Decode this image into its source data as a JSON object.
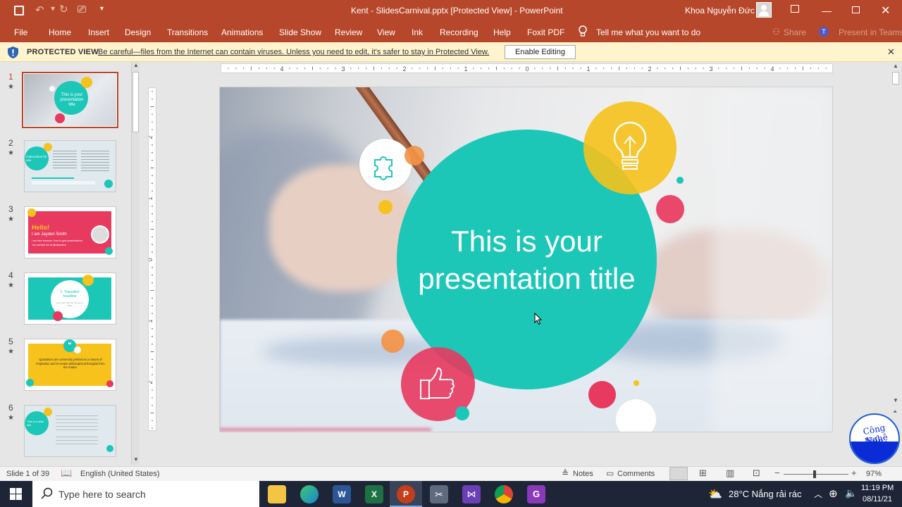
{
  "titlebar": {
    "doc_title": "Kent - SlidesCarnival.pptx [Protected View]  -  PowerPoint",
    "user_name": "Khoa Nguyễn Đức"
  },
  "ribbon": {
    "tabs": [
      "File",
      "Home",
      "Insert",
      "Design",
      "Transitions",
      "Animations",
      "Slide Show",
      "Review",
      "View",
      "Ink",
      "Recording",
      "Help",
      "Foxit PDF"
    ],
    "tell_me": "Tell me what you want to do",
    "share": "Share",
    "present_teams": "Present in Teams"
  },
  "protected": {
    "label": "PROTECTED VIEW",
    "message": "Be careful—files from the Internet can contain viruses. Unless you need to edit, it's safer to stay in Protected View.",
    "button": "Enable Editing"
  },
  "thumbnails": [
    {
      "num": "1",
      "title": "This is your presentation title"
    },
    {
      "num": "2",
      "title": "Instructions for use"
    },
    {
      "num": "3",
      "title": "Hello!",
      "sub": "I am Jayden Smith",
      "line1": "I am here because I love to give presentations.",
      "line2": "You can find me at @username"
    },
    {
      "num": "4",
      "title": "1. Transition headline",
      "sub": "Let's start with the first set of slides"
    },
    {
      "num": "5",
      "quote": "Quotations are commonly printed as a means of inspiration and to invoke philosophical thoughts from the reader."
    },
    {
      "num": "6",
      "title": "This is a slide title"
    }
  ],
  "ruler": {
    "h_labels": [
      "4",
      "3",
      "2",
      "1",
      "0",
      "1",
      "2",
      "3",
      "4"
    ],
    "v_labels": [
      "2",
      "1",
      "0",
      "1",
      "2"
    ]
  },
  "slide": {
    "title_line1": "This is your",
    "title_line2": "presentation title"
  },
  "status": {
    "slide_info": "Slide 1 of 39",
    "language": "English (United States)",
    "notes": "Notes",
    "comments": "Comments",
    "zoom": "97%"
  },
  "watermark": {
    "line1": "Công Nghệ",
    "line2": "Nền"
  },
  "taskbar": {
    "search_placeholder": "Type here to search",
    "weather": "28°C  Nắng rải rác",
    "time": "11:19 PM",
    "date": "08/11/21"
  },
  "colors": {
    "accent": "#b7472a",
    "teal": "#1cc7b8",
    "yellow": "#f6c21b",
    "pink": "#e8395f",
    "orange": "#f39447"
  }
}
